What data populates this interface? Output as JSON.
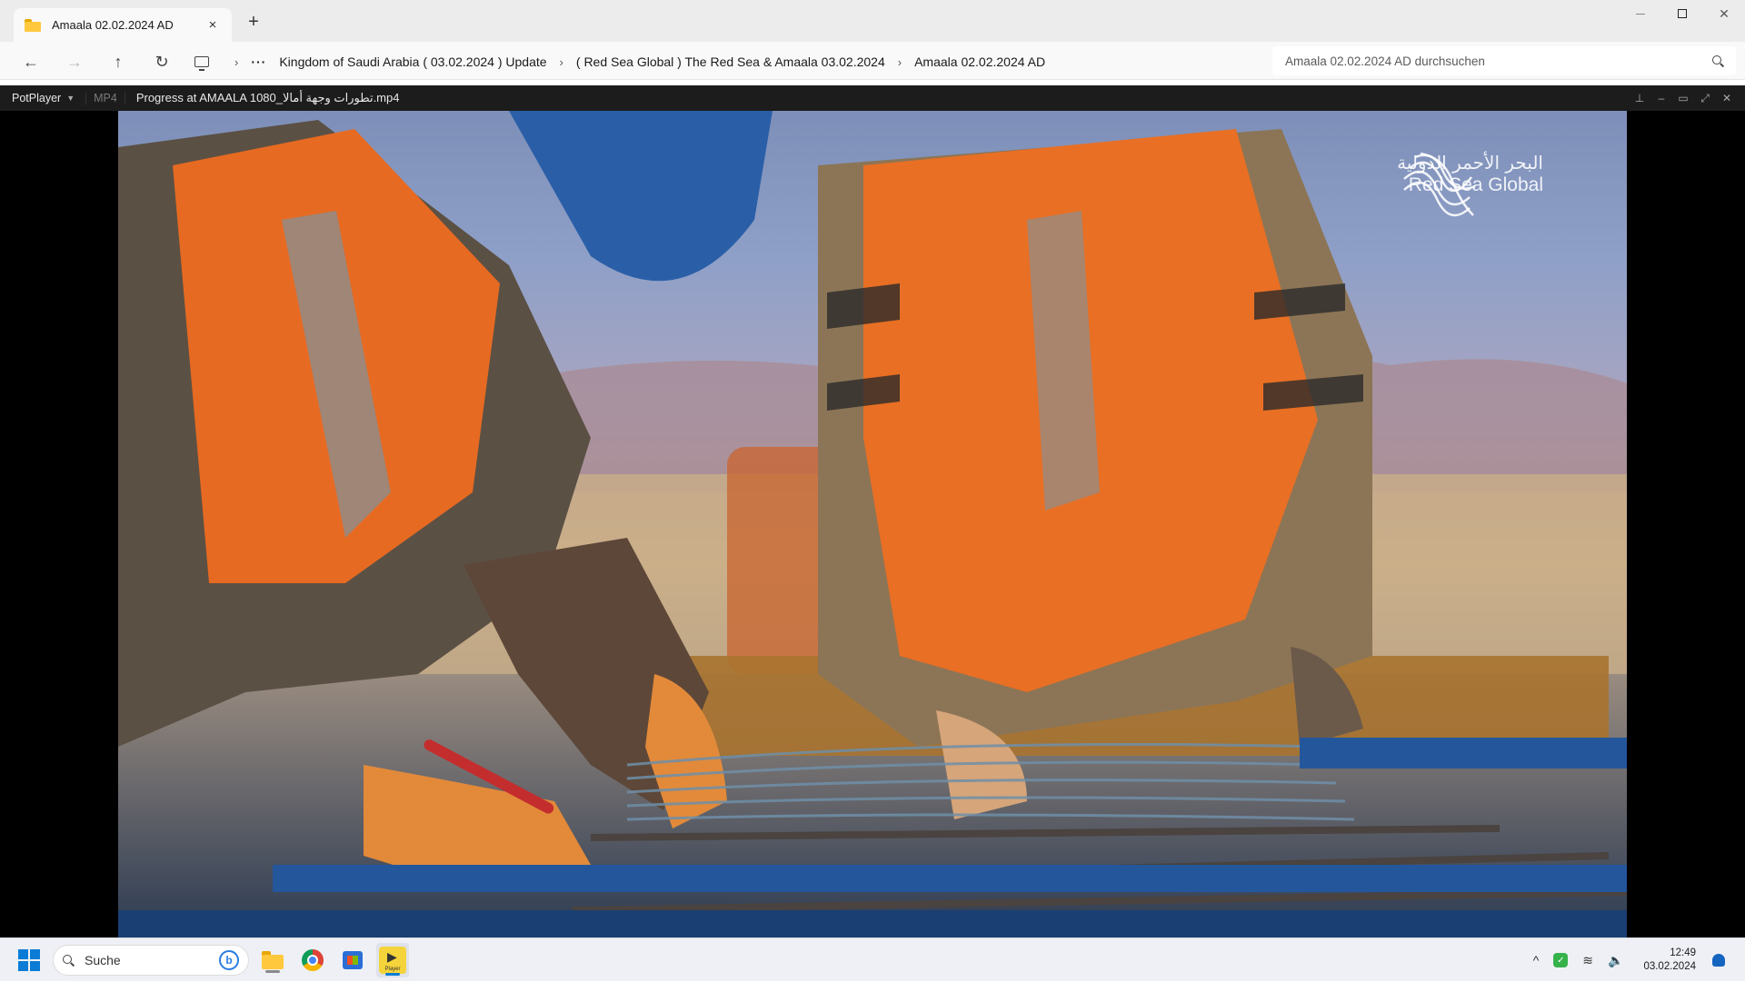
{
  "explorer": {
    "tab_title": "Amaala 02.02.2024 AD",
    "tab_close": "×",
    "new_tab": "+",
    "nav": {
      "back": "←",
      "forward": "→",
      "up": "↑",
      "refresh": "↻"
    },
    "breadcrumb": [
      "Kingdom of Saudi Arabia ( 03.02.2024 ) Update",
      "( Red Sea Global ) The Red Sea & Amaala 03.02.2024",
      "Amaala 02.02.2024 AD"
    ],
    "overflow": "···",
    "search_placeholder": "Amaala 02.02.2024 AD durchsuchen",
    "window_controls": {
      "close": "✕"
    }
  },
  "player": {
    "menu_label": "PotPlayer",
    "format": "MP4",
    "file_title": "Progress at AMAALA  1080_تطورات وجهة أمالا.mp4",
    "controls": {
      "pin": "⊥",
      "minimize": "–",
      "maximize": "▭",
      "fullscreen": "⤢",
      "close": "✕"
    },
    "watermark": {
      "arabic": "البحر الأحمر الدولية",
      "english": "Red Sea Global"
    }
  },
  "taskbar": {
    "search_label": "Suche",
    "bing_badge": "b",
    "pot_label": "Player",
    "tray": {
      "chevron": "^",
      "wifi": "≋",
      "volume": "🔈"
    },
    "time": "12:49",
    "date": "03.02.2024"
  }
}
